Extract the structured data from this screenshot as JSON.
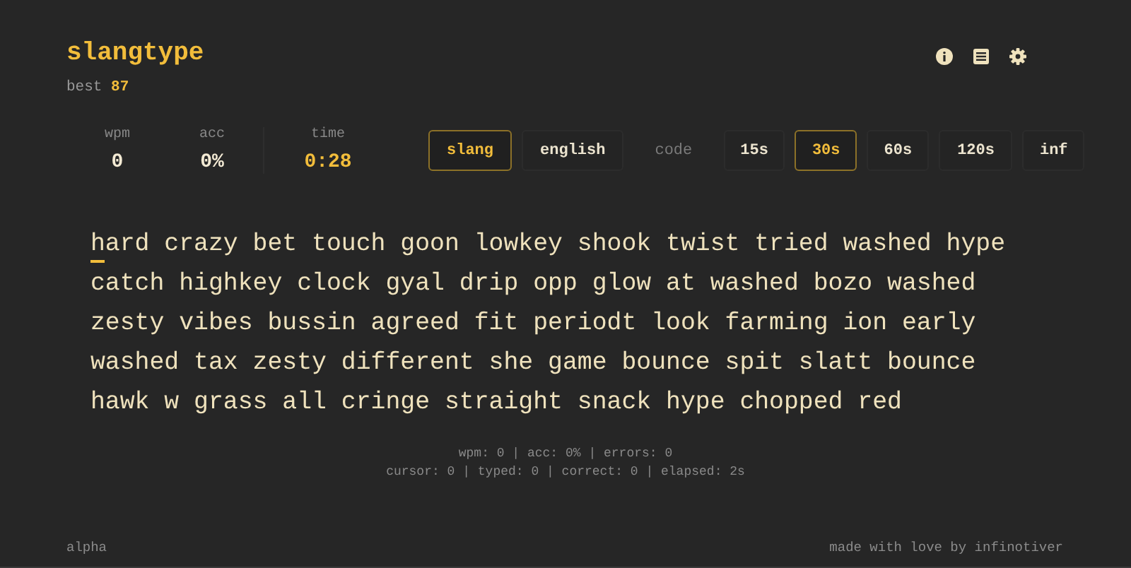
{
  "header": {
    "title": "slangtype",
    "best_label": "best",
    "best_value": "87"
  },
  "stats": [
    {
      "label": "wpm",
      "value": "0",
      "highlight": false
    },
    {
      "label": "acc",
      "value": "0%",
      "highlight": false
    },
    {
      "label": "time",
      "value": "0:28",
      "highlight": true
    }
  ],
  "modes": [
    {
      "label": "slang",
      "selected": true,
      "disabled": false
    },
    {
      "label": "english",
      "selected": false,
      "disabled": false
    },
    {
      "label": "code",
      "selected": false,
      "disabled": true
    }
  ],
  "durations": [
    {
      "label": "15s",
      "selected": false
    },
    {
      "label": "30s",
      "selected": true
    },
    {
      "label": "60s",
      "selected": false
    },
    {
      "label": "120s",
      "selected": false
    },
    {
      "label": "inf",
      "selected": false
    }
  ],
  "words": [
    "hard crazy bet touch goon lowkey shook twist tried washed hype",
    "catch highkey clock gyal drip opp glow at washed bozo washed",
    "zesty vibes bussin agreed fit periodt look farming ion early",
    "washed tax zesty different she game bounce spit slatt bounce",
    "hawk w grass all cringe straight snack hype chopped red"
  ],
  "debug": [
    "wpm: 0 | acc: 0% | errors: 0",
    "cursor: 0 | typed: 0 | correct: 0 | elapsed: 2s"
  ],
  "footer": {
    "left": "alpha",
    "right": "made with love by infinotiver"
  }
}
